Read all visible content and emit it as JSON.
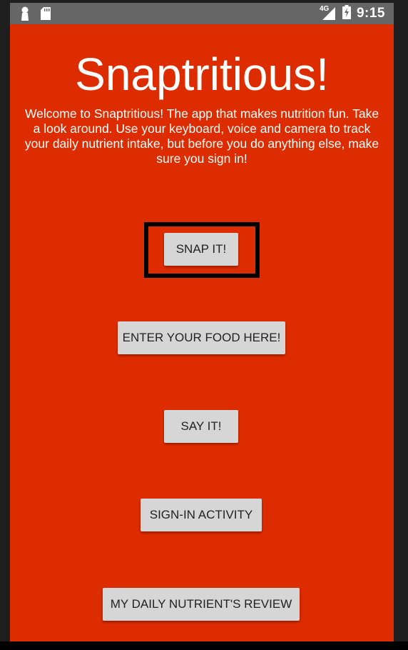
{
  "status_bar": {
    "time": "9:15",
    "network_label": "4G",
    "icons": [
      "notification-person-icon",
      "sd-card-icon",
      "signal-icon",
      "battery-charging-icon"
    ]
  },
  "app": {
    "title": "Snaptritious!",
    "welcome": "Welcome to Snaptritious! The app that makes nutrition fun. Take a look around. Use your keyboard, voice and camera to track your daily nutrient intake, but before you do anything else, make sure you sign in!"
  },
  "buttons": {
    "snap_it": "SNAP IT!",
    "enter_food": "ENTER YOUR FOOD HERE!",
    "say_it": "SAY IT!",
    "sign_in": "SIGN-IN ACTIVITY",
    "daily_review": "MY DAILY NUTRIENT'S REVIEW"
  },
  "colors": {
    "background": "#dd2c00",
    "status_bar": "#666666",
    "button": "#d6d6d6",
    "button_text": "#222222",
    "highlight": "#000000"
  }
}
